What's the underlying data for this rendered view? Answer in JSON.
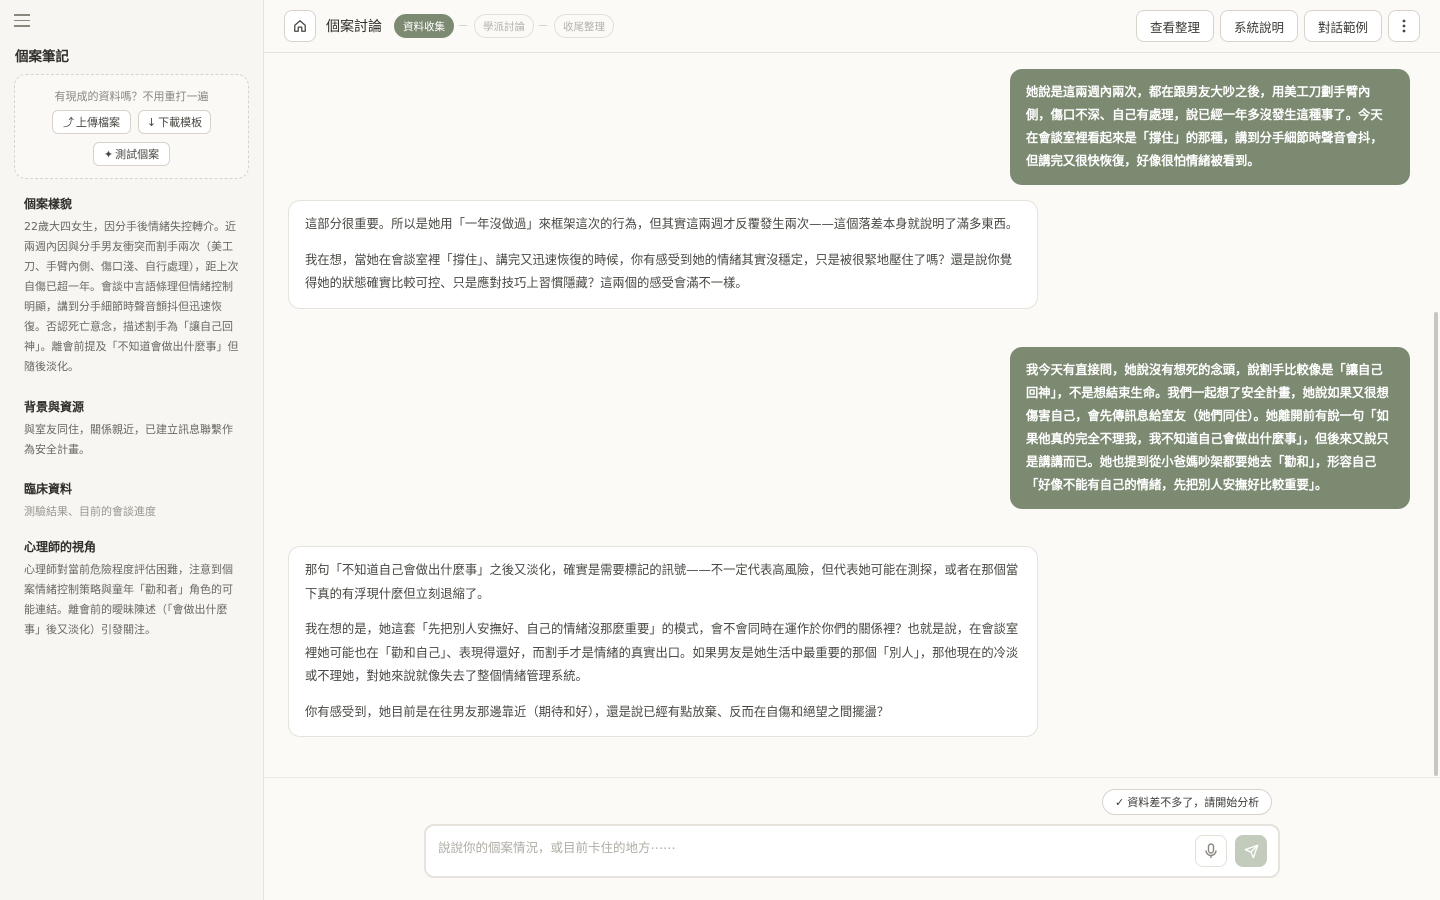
{
  "sidebar": {
    "title": "個案筆記",
    "upload_hint": "有現成的資料嗎？不用重打一遍",
    "upload_label": "上傳檔案",
    "download_label": "下載模板",
    "test_label": "測試個案",
    "sections": [
      {
        "heading": "個案樣貌",
        "body": "22歲大四女生，因分手後情緒失控轉介。近兩週內因與分手男友衝突而割手兩次（美工刀、手臂內側、傷口淺、自行處理），距上次自傷已超一年。會談中言語條理但情緒控制明顯，講到分手細節時聲音顫抖但迅速恢復。否認死亡意念，描述割手為「讓自己回神」。離會前提及「不知道會做出什麼事」但隨後淡化。"
      },
      {
        "heading": "背景與資源",
        "body": "與室友同住，關係親近，已建立訊息聯繫作為安全計畫。"
      },
      {
        "heading": "臨床資料",
        "body": "測驗結果、目前的會談進度"
      },
      {
        "heading": "心理師的視角",
        "body": "心理師對當前危險程度評估困難，注意到個案情緒控制策略與童年「勸和者」角色的可能連結。離會前的曖昧陳述（「會做出什麼事」後又淡化）引發關注。"
      }
    ]
  },
  "topbar": {
    "title": "個案討論",
    "steps": [
      "資料收集",
      "學派討論",
      "收尾整理"
    ],
    "buttons": [
      "查看整理",
      "系統說明",
      "對話範例"
    ]
  },
  "messages": [
    {
      "role": "user",
      "paragraphs": [
        "她說是這兩週內兩次，都在跟男友大吵之後，用美工刀劃手臂內側，傷口不深、自己有處理，說已經一年多沒發生這種事了。今天在會談室裡看起來是「撐住」的那種，講到分手細節時聲音會抖，但講完又很快恢復，好像很怕情緒被看到。"
      ]
    },
    {
      "role": "assistant",
      "paragraphs": [
        "這部分很重要。所以是她用「一年沒做過」來框架這次的行為，但其實這兩週才反覆發生兩次——這個落差本身就說明了滿多東西。",
        "我在想，當她在會談室裡「撐住」、講完又迅速恢復的時候，你有感受到她的情緒其實沒穩定，只是被很緊地壓住了嗎？還是說你覺得她的狀態確實比較可控、只是應對技巧上習慣隱藏？這兩個的感受會滿不一樣。"
      ]
    },
    {
      "role": "user",
      "paragraphs": [
        "我今天有直接問，她說沒有想死的念頭，說割手比較像是「讓自己回神」，不是想結束生命。我們一起想了安全計畫，她說如果又很想傷害自己，會先傳訊息給室友（她們同住）。她離開前有說一句「如果他真的完全不理我，我不知道自己會做出什麼事」，但後來又說只是講講而已。她也提到從小爸媽吵架都要她去「勸和」，形容自己「好像不能有自己的情緒，先把別人安撫好比較重要」。"
      ]
    },
    {
      "role": "assistant",
      "paragraphs": [
        "那句「不知道自己會做出什麼事」之後又淡化，確實是需要標記的訊號——不一定代表高風險，但代表她可能在測探，或者在那個當下真的有浮現什麼但立刻退縮了。",
        "我在想的是，她這套「先把別人安撫好、自己的情緒沒那麼重要」的模式，會不會同時在運作於你們的關係裡？也就是說，在會談室裡她可能也在「勸和自己」、表現得還好，而割手才是情緒的真實出口。如果男友是她生活中最重要的那個「別人」，那他現在的冷淡或不理她，對她來說就像失去了整個情緒管理系統。",
        "你有感受到，她目前是在往男友那邊靠近（期待和好），還是說已經有點放棄、反而在自傷和絕望之間擺盪？"
      ]
    }
  ],
  "composer": {
    "ready_label": "資料差不多了，請開始分析",
    "placeholder": "說說你的個案情況，或目前卡住的地方⋯⋯"
  },
  "colors": {
    "accent": "#7c8a72",
    "send_disabled": "#c3cbbd"
  }
}
